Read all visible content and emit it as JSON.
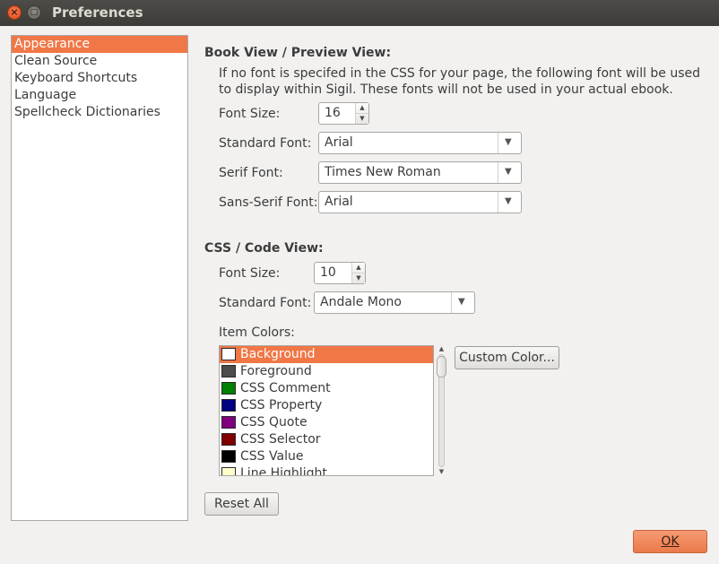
{
  "window": {
    "title": "Preferences"
  },
  "sidebar": {
    "items": [
      {
        "label": "Appearance"
      },
      {
        "label": "Clean Source"
      },
      {
        "label": "Keyboard Shortcuts"
      },
      {
        "label": "Language"
      },
      {
        "label": "Spellcheck Dictionaries"
      }
    ],
    "selected": "Appearance"
  },
  "book_view": {
    "title": "Book View / Preview View:",
    "description": "If no font is specifed in the CSS for your page, the following font will be used to display within Sigil. These fonts will not be used in your actual ebook.",
    "font_size_label": "Font Size:",
    "font_size_value": "16",
    "standard_font_label": "Standard Font:",
    "standard_font_value": "Arial",
    "serif_font_label": "Serif Font:",
    "serif_font_value": "Times New Roman",
    "sans_serif_font_label": "Sans-Serif Font:",
    "sans_serif_font_value": "Arial"
  },
  "code_view": {
    "title": "CSS / Code View:",
    "font_size_label": "Font Size:",
    "font_size_value": "10",
    "standard_font_label": "Standard Font:",
    "standard_font_value": "Andale Mono",
    "item_colors_label": "Item Colors:",
    "item_colors": [
      {
        "name": "Background",
        "color": "#ffffff"
      },
      {
        "name": "Foreground",
        "color": "#4c4c4c"
      },
      {
        "name": "CSS Comment",
        "color": "#008000"
      },
      {
        "name": "CSS Property",
        "color": "#000080"
      },
      {
        "name": "CSS Quote",
        "color": "#800080"
      },
      {
        "name": "CSS Selector",
        "color": "#800000"
      },
      {
        "name": "CSS Value",
        "color": "#000000"
      },
      {
        "name": "Line Highlight",
        "color": "#ffffcc"
      }
    ],
    "selected_item": "Background",
    "custom_color_label": "Custom Color...",
    "reset_all_label": "Reset All"
  },
  "footer": {
    "ok_label": "OK"
  },
  "colors": {
    "accent": "#f07746",
    "titlebar": "#3c3b37",
    "background": "#f2f1f0"
  }
}
